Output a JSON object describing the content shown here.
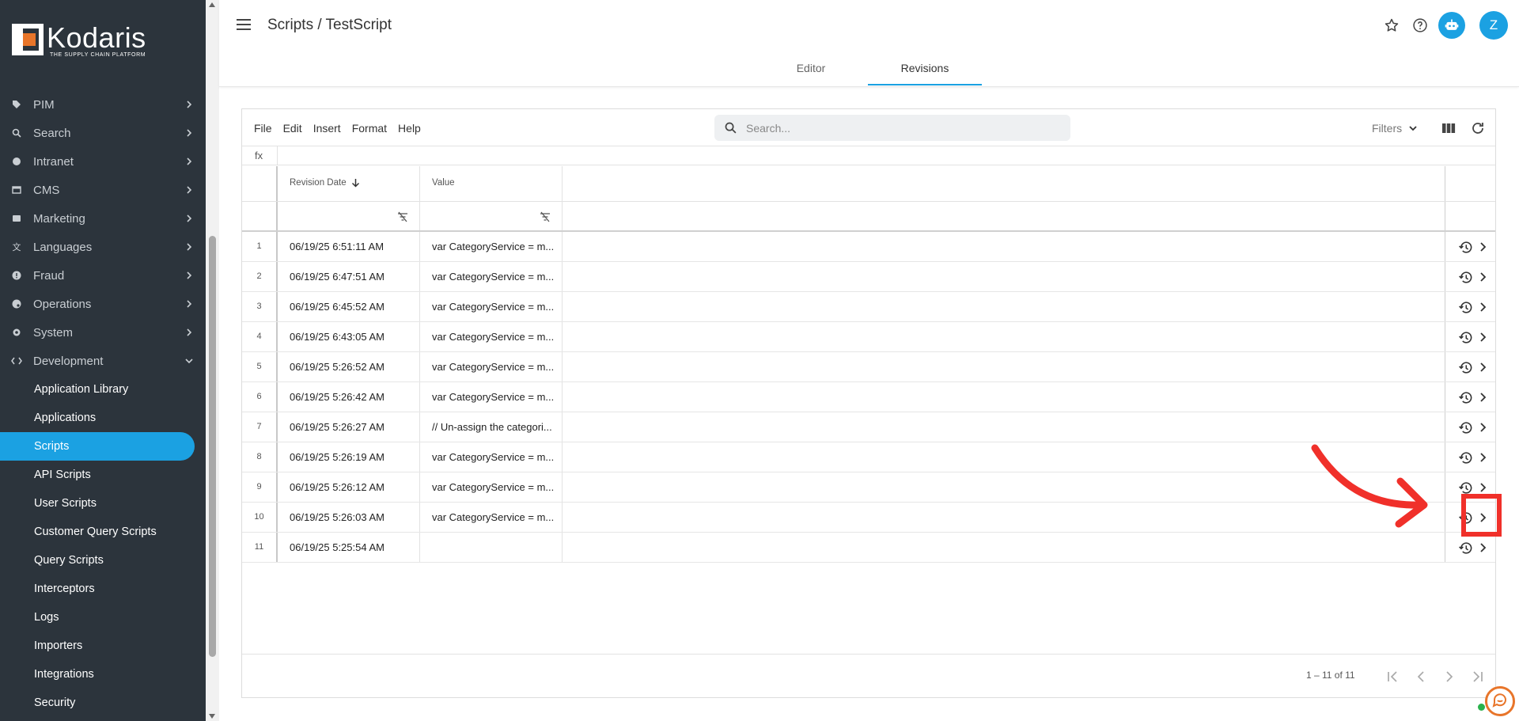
{
  "sidebar": {
    "logo_text": "Kodaris",
    "logo_tagline": "THE SUPPLY CHAIN PLATFORM",
    "nav": [
      {
        "label": "PIM"
      },
      {
        "label": "Search"
      },
      {
        "label": "Intranet"
      },
      {
        "label": "CMS"
      },
      {
        "label": "Marketing"
      },
      {
        "label": "Languages"
      },
      {
        "label": "Fraud"
      },
      {
        "label": "Operations"
      },
      {
        "label": "System"
      },
      {
        "label": "Development"
      }
    ],
    "sub_items": [
      {
        "label": "Application Library"
      },
      {
        "label": "Applications"
      },
      {
        "label": "Scripts"
      },
      {
        "label": "API Scripts"
      },
      {
        "label": "User Scripts"
      },
      {
        "label": "Customer Query Scripts"
      },
      {
        "label": "Query Scripts"
      },
      {
        "label": "Interceptors"
      },
      {
        "label": "Logs"
      },
      {
        "label": "Importers"
      },
      {
        "label": "Integrations"
      },
      {
        "label": "Security"
      }
    ],
    "active_item": "Scripts",
    "active_color": "#1ba1e2"
  },
  "header": {
    "breadcrumb": "Scripts / TestScript",
    "avatar_initial": "Z",
    "tabs": [
      {
        "label": "Editor"
      },
      {
        "label": "Revisions"
      }
    ],
    "active_tab": "Revisions"
  },
  "toolbar": {
    "menu": [
      {
        "label": "File"
      },
      {
        "label": "Edit"
      },
      {
        "label": "Insert"
      },
      {
        "label": "Format"
      },
      {
        "label": "Help"
      }
    ],
    "search_placeholder": "Search...",
    "filters_label": "Filters",
    "fx_label": "fx"
  },
  "grid": {
    "columns": [
      {
        "label": "Revision Date"
      },
      {
        "label": "Value"
      }
    ],
    "rows": [
      {
        "num": "1",
        "date": "06/19/25 6:51:11 AM",
        "value": "var CategoryService = m..."
      },
      {
        "num": "2",
        "date": "06/19/25 6:47:51 AM",
        "value": "var CategoryService = m..."
      },
      {
        "num": "3",
        "date": "06/19/25 6:45:52 AM",
        "value": "var CategoryService = m..."
      },
      {
        "num": "4",
        "date": "06/19/25 6:43:05 AM",
        "value": "var CategoryService = m..."
      },
      {
        "num": "5",
        "date": "06/19/25 5:26:52 AM",
        "value": "var CategoryService = m..."
      },
      {
        "num": "6",
        "date": "06/19/25 5:26:42 AM",
        "value": "var CategoryService = m..."
      },
      {
        "num": "7",
        "date": "06/19/25 5:26:27 AM",
        "value": "// Un-assign the categori..."
      },
      {
        "num": "8",
        "date": "06/19/25 5:26:19 AM",
        "value": "var CategoryService = m..."
      },
      {
        "num": "9",
        "date": "06/19/25 5:26:12 AM",
        "value": "var CategoryService = m..."
      },
      {
        "num": "10",
        "date": "06/19/25 5:26:03 AM",
        "value": "var CategoryService = m..."
      },
      {
        "num": "11",
        "date": "06/19/25 5:25:54 AM",
        "value": ""
      }
    ],
    "pager_text": "1 – 11 of 11"
  },
  "annotation_color": "#f0302a"
}
